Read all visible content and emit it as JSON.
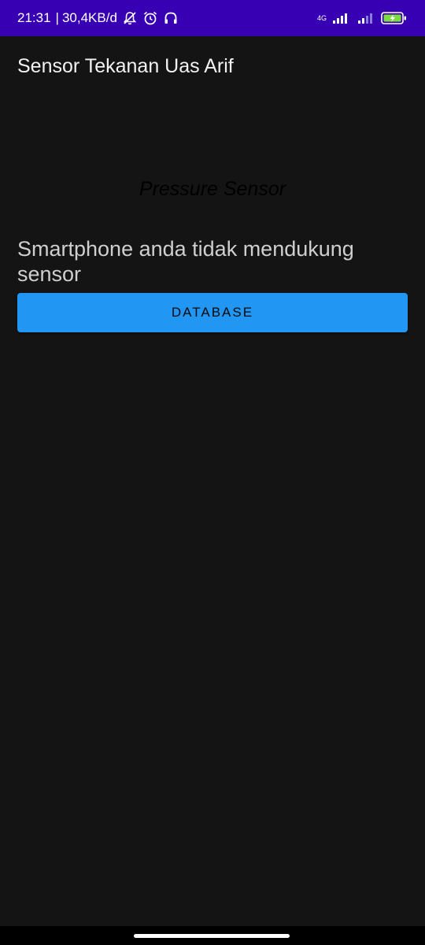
{
  "status_bar": {
    "time": "21:31",
    "separator": "|",
    "net_speed": "30,4KB/d",
    "network_type": "4G",
    "icons": [
      "mute-notification-icon",
      "alarm-icon",
      "headphones-icon",
      "signal-icon",
      "signal-weak-icon",
      "battery-charging-icon"
    ],
    "background": "#3700b3"
  },
  "app_bar": {
    "title": "Sensor Tekanan Uas Arif"
  },
  "main": {
    "sensor_name": "Pressure Sensor",
    "message": "Smartphone anda tidak mendukung sensor",
    "database_button": "DATABASE",
    "button_color": "#2196f3"
  }
}
